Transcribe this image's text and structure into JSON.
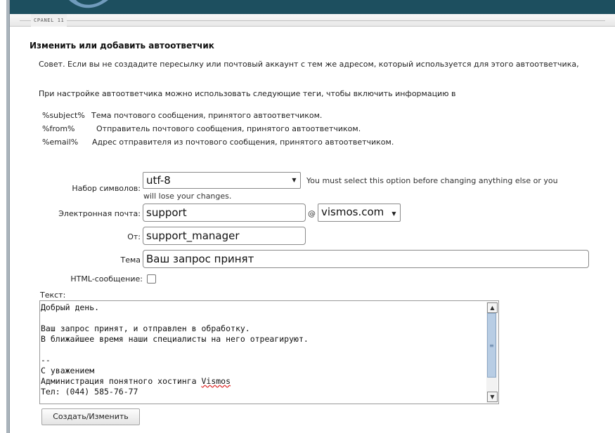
{
  "header": {
    "brand": "CPANEL 11"
  },
  "page": {
    "title": "Изменить или добавить автоответчик",
    "tip": "Совет. Если вы не создадите пересылку или почтовый аккаунт с тем же адресом, который используется для этого автоответчика,",
    "tags_intro": "При настройке автоответчика можно использовать следующие теги, чтобы включить информацию в",
    "tags": [
      {
        "key": "%subject%",
        "desc": "Тема почтового сообщения, принятого автоответчиком."
      },
      {
        "key": "%from%",
        "desc": "Отправитель почтового сообщения, принятого автоответчиком."
      },
      {
        "key": "%email%",
        "desc": "Адрес отправителя из почтового сообщения, принятого автоответчиком."
      }
    ]
  },
  "form": {
    "charset_label": "Набор символов:",
    "charset_value": "utf-8",
    "charset_warning_1": "You must select this option before changing anything else or you",
    "charset_warning_2": "will lose your changes.",
    "email_label": "Электронная почта:",
    "email_value": "support",
    "at_sign": "@",
    "domain_value": "vismos.com",
    "from_label": "От:",
    "from_value": "support_manager",
    "subject_label": "Тема",
    "subject_value": "Ваш запрос принят",
    "html_label": "HTML-сообщение:",
    "html_checked": false,
    "body_label": "Текст:",
    "body_lines": {
      "l1": "Добрый день.",
      "l2": "",
      "l3": "Ваш запрос принят, и отправлен в обработку.",
      "l4": "В ближайшее время наши специалисты на него отреагируют.",
      "l5": "",
      "l6": "--",
      "l7": "С уважением",
      "l8_prefix": "Администрация понятного хостинга ",
      "l8_word": "Vismos",
      "l9": "Тел: (044) 585-76-77"
    },
    "submit_label": "Создать/Изменить"
  },
  "icons": {
    "dropdown": "chevron-down-icon",
    "scroll_up": "arrow-up-icon",
    "scroll_down": "arrow-down-icon"
  },
  "colors": {
    "topbar": "#1d4f5f",
    "scroll_thumb": "#b8cde4"
  }
}
